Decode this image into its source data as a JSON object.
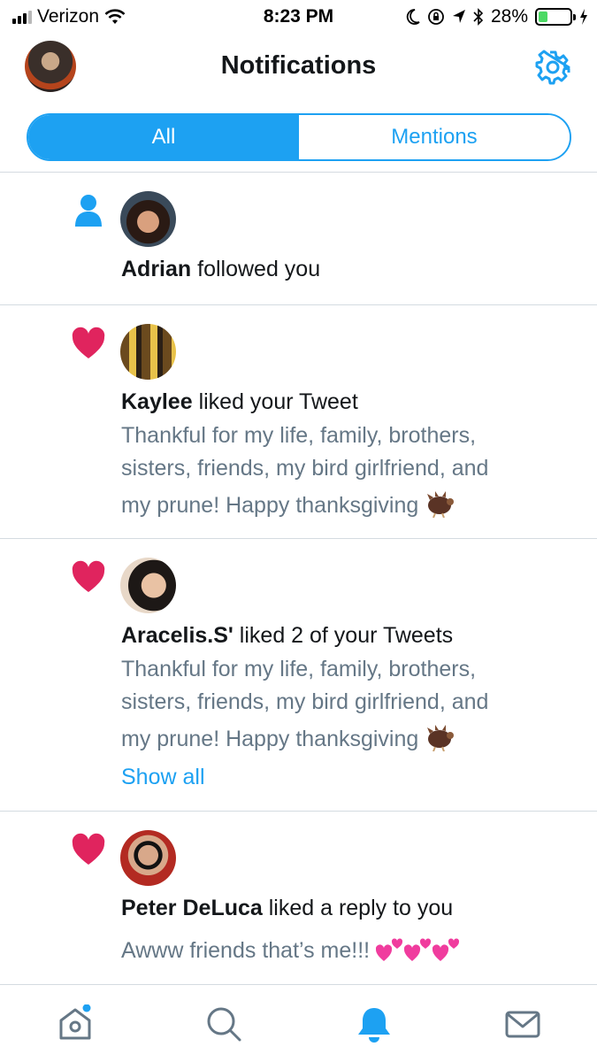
{
  "status_bar": {
    "carrier": "Verizon",
    "time": "8:23 PM",
    "battery": "28%",
    "battery_level": 0.28
  },
  "header": {
    "title": "Notifications",
    "avatar_icon": "profile-avatar",
    "settings_icon": "gear-icon"
  },
  "tabs": {
    "all_label": "All",
    "mentions_label": "Mentions",
    "selected": "All"
  },
  "notifications": [
    {
      "type": "follow",
      "icon": "person-icon",
      "name": "Adrian",
      "action": " followed you"
    },
    {
      "type": "like",
      "icon": "heart-icon",
      "name": "Kaylee",
      "action": " liked your Tweet",
      "tweet_line1": "Thankful for my life, family, brothers,",
      "tweet_line2": "sisters, friends, my bird girlfriend, and",
      "tweet_line3": "my prune! Happy thanksgiving"
    },
    {
      "type": "like",
      "icon": "heart-icon",
      "name": "Aracelis.S'",
      "action": " liked 2 of your Tweets",
      "tweet_line1": "Thankful for my life, family, brothers,",
      "tweet_line2": "sisters, friends, my bird girlfriend, and",
      "tweet_line3": "my prune! Happy thanksgiving",
      "show_all": "Show all"
    },
    {
      "type": "like",
      "icon": "heart-icon",
      "name": "Peter DeLuca",
      "action": " liked a reply to you",
      "tweet_line1": "Awww friends that’s me!!!"
    }
  ],
  "tabbar": {
    "items": [
      "home-icon",
      "search-icon",
      "bell-icon",
      "mail-icon"
    ],
    "active": "bell-icon"
  },
  "colors": {
    "accent": "#1da1f2",
    "like": "#e0245e",
    "secondary_text": "#657786",
    "divider": "#d4dbe1"
  }
}
